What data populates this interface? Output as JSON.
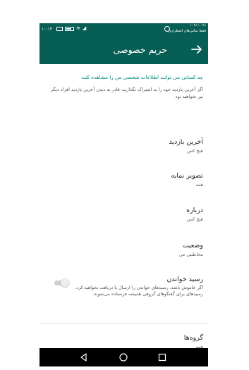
{
  "status_bar": {
    "time": "۱۰:۱۴",
    "right_line1": "۱۰:۴۸.۱۰:۴۸",
    "right_line2": "فقط تماس‌های اضطراری"
  },
  "toolbar": {
    "title": "حریم خصوصی",
    "back_icon": "arrow-back-icon"
  },
  "privacy": {
    "header": "چه کسانی می توانند اطلاعات شخصی من را مشاهده کنند",
    "description": "اگر آخرین بازدید خود را به اشتراک نگذارید، قادر به دیدن آخرین بازدید افراد دیگر نیز نخواهید بود"
  },
  "settings": {
    "last_seen": {
      "title": "آخرین بازدید",
      "value": "هیچ کس"
    },
    "profile_photo": {
      "title": "تصویر نمایه",
      "value": "همه"
    },
    "about": {
      "title": "درباره",
      "value": "هیچ کس"
    },
    "status": {
      "title": "وضعیت",
      "value": "مخاطبین من"
    },
    "read_receipts": {
      "title": "رسید خواندن",
      "description": "اگر خاموش باشد، رسیدهای خواندن را ارسال یا دریافت نخواهید کرد. رسیدهای برای گفتگوهای گروهی همیشه فرستاده می‌شوند.",
      "enabled": false
    },
    "groups": {
      "title": "گروه‌ها",
      "value": "همه"
    }
  },
  "nav": {
    "back_icon": "nav-back-icon",
    "home_icon": "nav-home-icon",
    "recents_icon": "nav-recents-icon"
  },
  "colors": {
    "primary": "#075e54",
    "accent": "#00897b"
  }
}
